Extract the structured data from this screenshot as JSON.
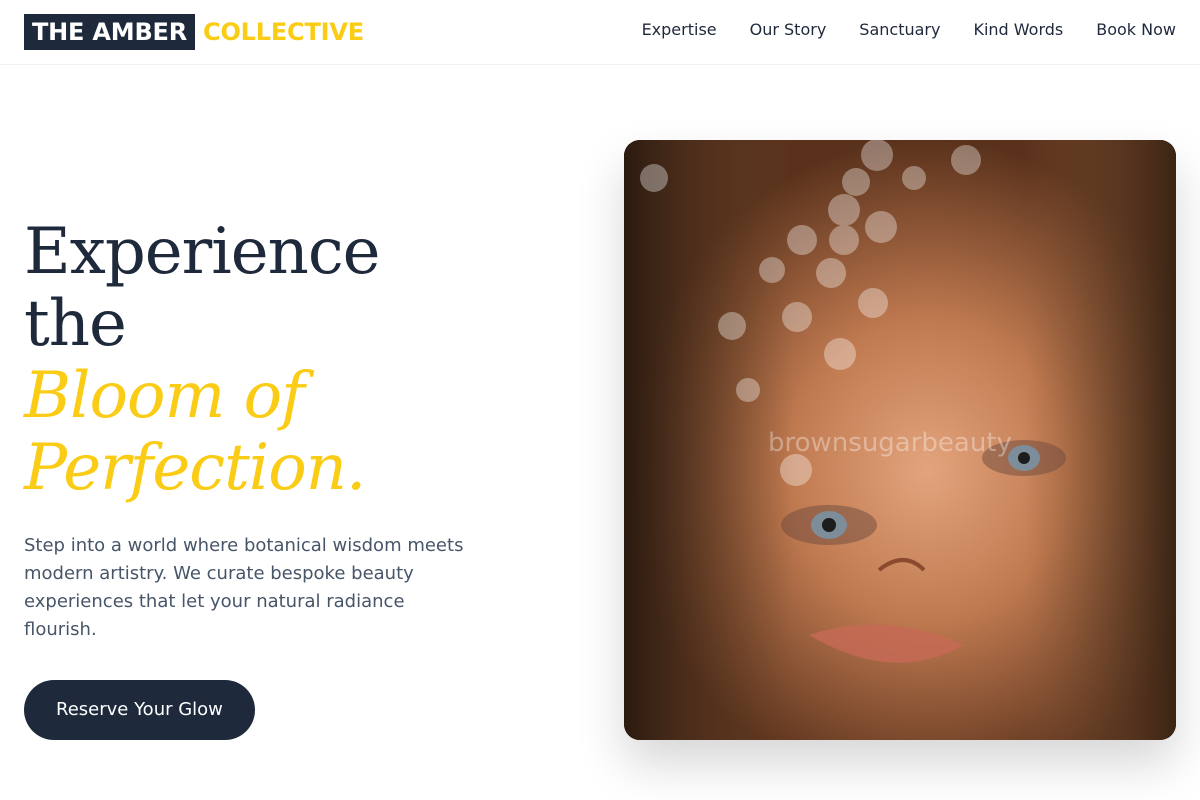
{
  "brand": {
    "name_dark": "THE AMBER",
    "name_accent": "COLLECTIVE"
  },
  "nav": {
    "items": [
      {
        "label": "Expertise"
      },
      {
        "label": "Our Story"
      },
      {
        "label": "Sanctuary"
      },
      {
        "label": "Kind Words"
      },
      {
        "label": "Book Now"
      }
    ]
  },
  "hero": {
    "headline_line1": "Experience the",
    "headline_accent1": "Bloom of",
    "headline_accent2": "Perfection.",
    "description": "Step into a world where botanical wisdom meets modern artistry. We curate bespoke beauty experiences that let your natural radiance flourish.",
    "cta_label": "Reserve Your Glow",
    "image_watermark": "brownsugarbeauty"
  },
  "colors": {
    "primary": "#1e293b",
    "accent": "#facc15",
    "muted_text": "#475569"
  }
}
